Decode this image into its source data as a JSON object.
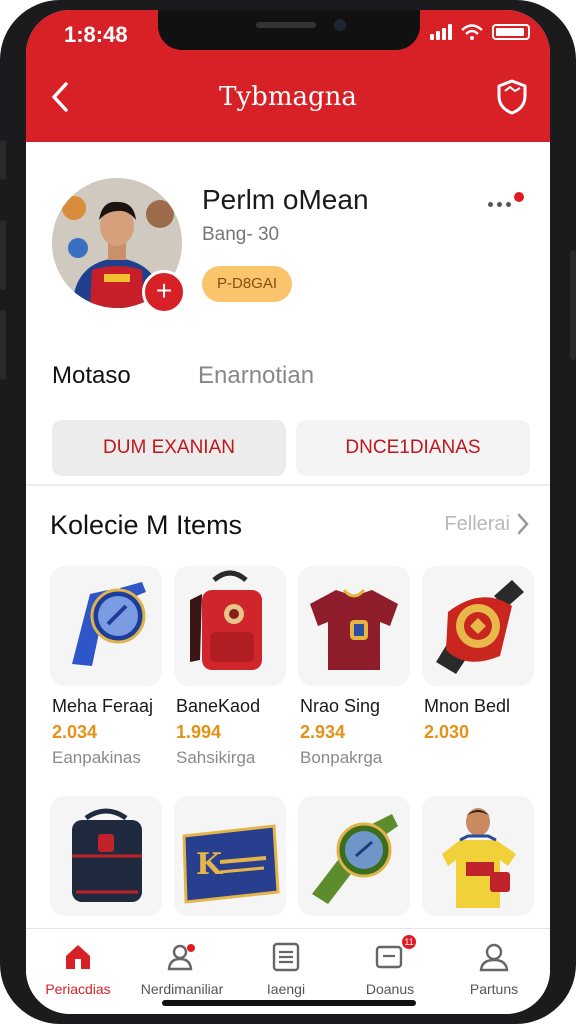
{
  "status_bar": {
    "time": "1:8:48"
  },
  "header": {
    "title": "Tybmagna"
  },
  "profile": {
    "name": "Perlm oMean",
    "subtitle": "Bang- 30",
    "badge": "P-D8GAI",
    "tabs": [
      "Motaso",
      "Enarnotian"
    ],
    "actions": [
      "DUM EXANIAN",
      "DNCE1DIANAS"
    ]
  },
  "collection": {
    "title": "Kolecie M Items",
    "link": "Fellerai",
    "items": [
      {
        "name": "Meha Feraaj",
        "price": "2.034",
        "category": "Eanpakinas",
        "icon": "watch-icon",
        "color": "#2f56c9"
      },
      {
        "name": "BaneKaod",
        "price": "1.994",
        "category": "Sahsikirga",
        "icon": "backpack-icon",
        "color": "#d0262b"
      },
      {
        "name": "Nrao Sing",
        "price": "2.934",
        "category": "Bonpakrga",
        "icon": "jersey-icon",
        "color": "#8e1c2a"
      },
      {
        "name": "Mnon Bedl",
        "price": "2.030",
        "category": "",
        "icon": "medal-icon",
        "color": "#c9261f"
      },
      {
        "name": "",
        "price": "",
        "category": "",
        "icon": "bag-icon",
        "color": "#1f2a3e"
      },
      {
        "name": "",
        "price": "",
        "category": "",
        "icon": "banner-icon",
        "color": "#283e8f"
      },
      {
        "name": "",
        "price": "",
        "category": "",
        "icon": "green-watch-icon",
        "color": "#5d8c2c"
      },
      {
        "name": "",
        "price": "",
        "category": "",
        "icon": "player-figure-icon",
        "color": "#f1d13a"
      }
    ]
  },
  "tabbar": {
    "items": [
      {
        "label": "Periacdias",
        "icon": "home-icon",
        "active": true,
        "badge": ""
      },
      {
        "label": "Nerdimaniliar",
        "icon": "user-add-icon",
        "active": false,
        "badge": ""
      },
      {
        "label": "Iaengi",
        "icon": "list-icon",
        "active": false,
        "badge": ""
      },
      {
        "label": "Doanus",
        "icon": "chat-icon",
        "active": false,
        "badge": "11"
      },
      {
        "label": "Partuns",
        "icon": "profile-icon",
        "active": false,
        "badge": ""
      }
    ]
  },
  "colors": {
    "brand_red": "#d82027",
    "accent_gold": "#e29217",
    "badge_yellow": "#f9c46b"
  }
}
